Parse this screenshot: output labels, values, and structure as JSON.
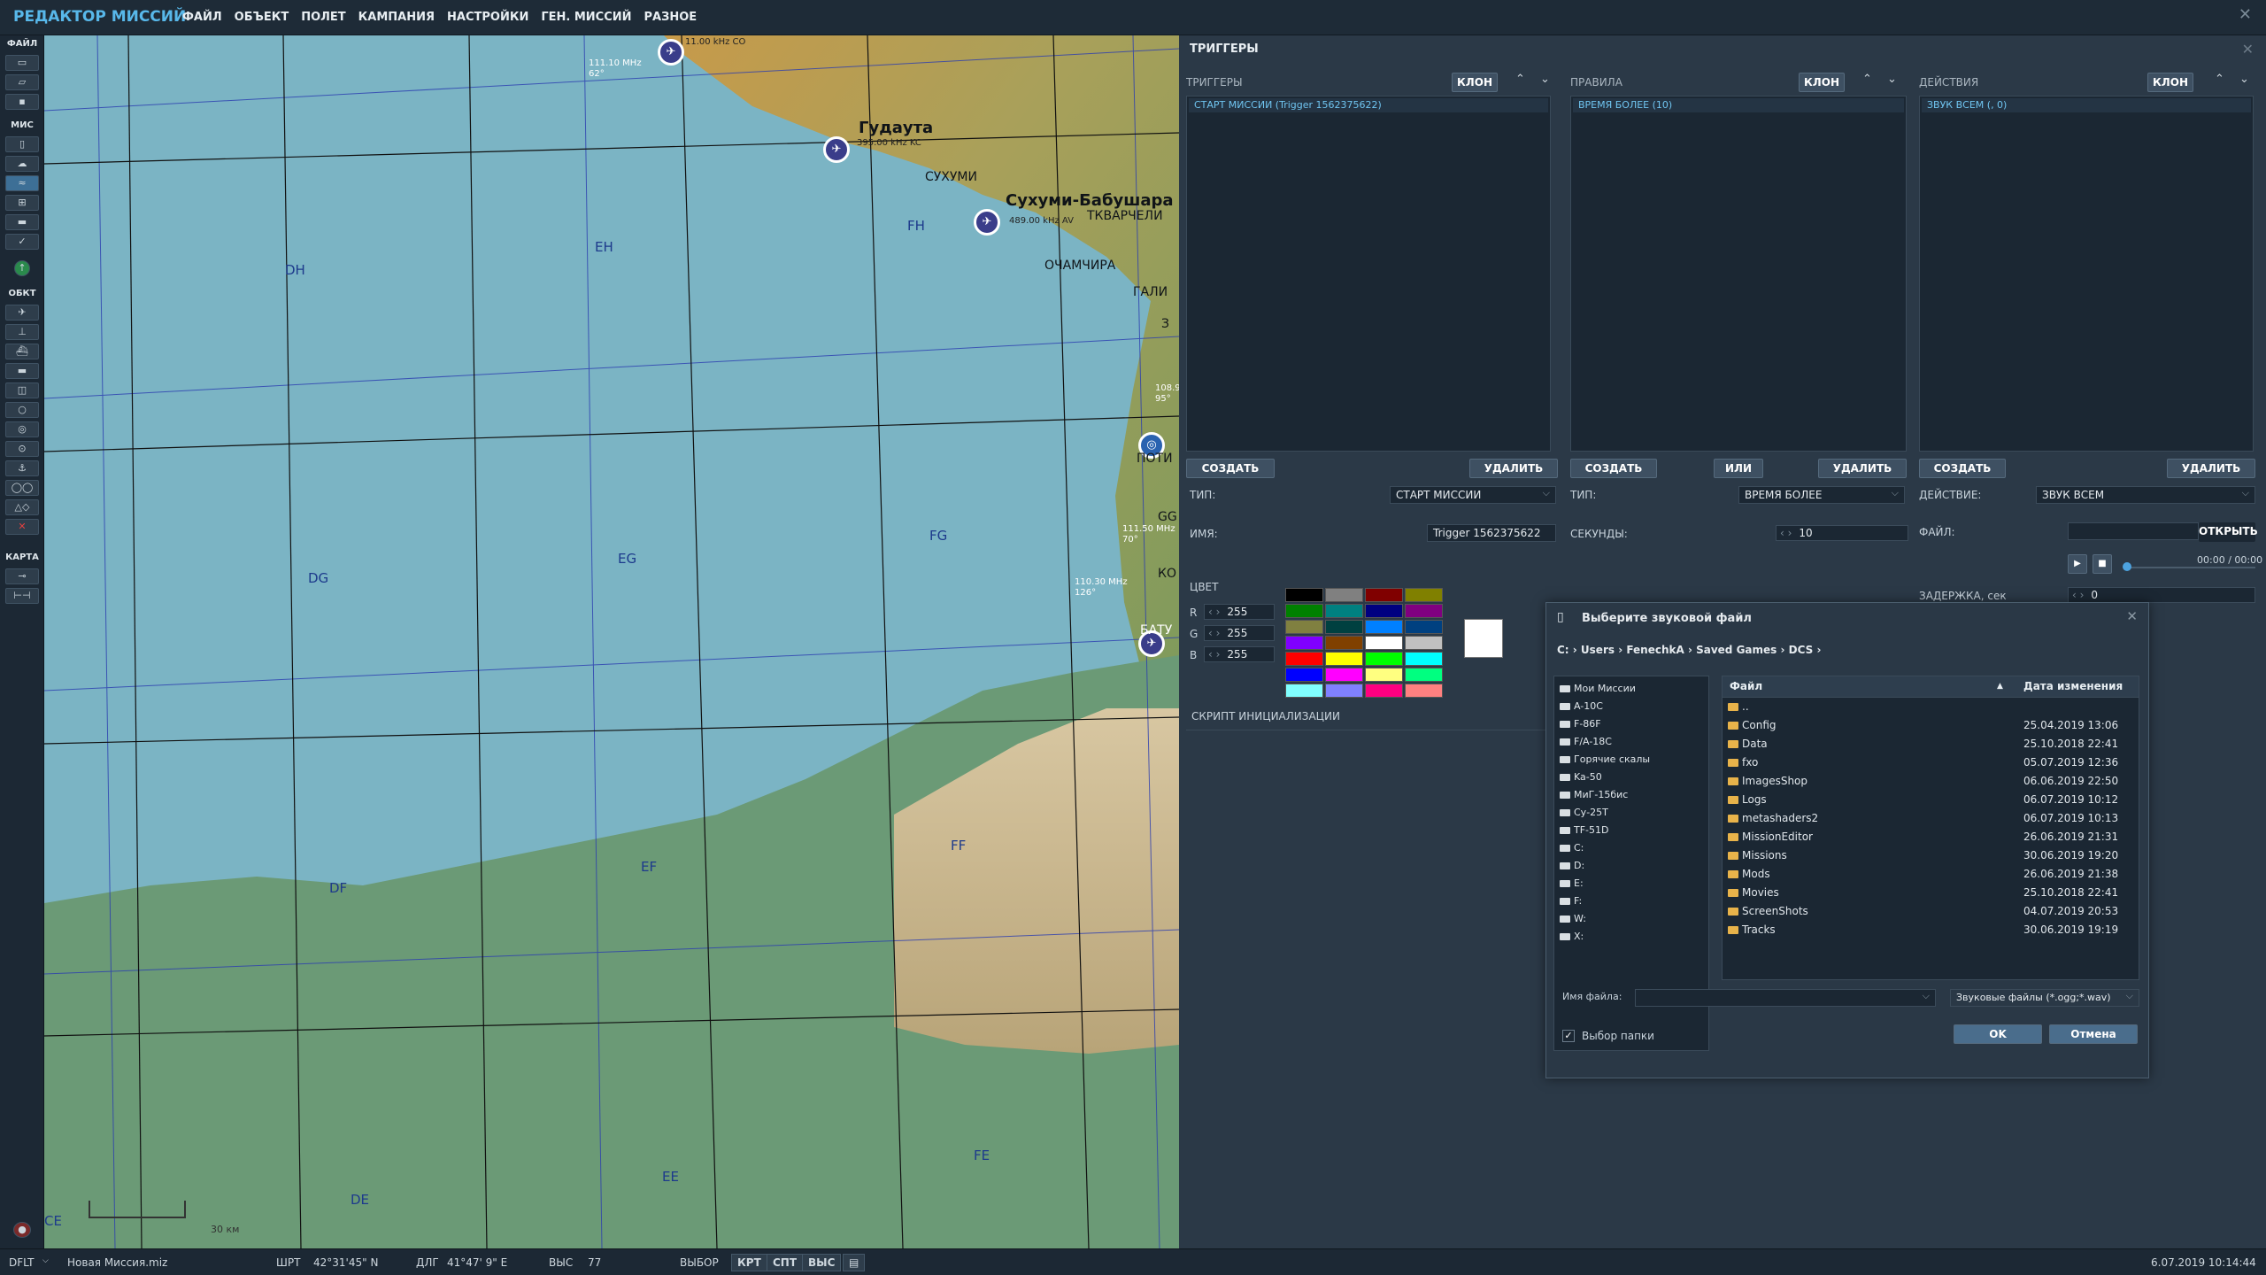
{
  "app": {
    "title": "РЕДАКТОР МИССИЙ",
    "close": "✕"
  },
  "menu": [
    "ФАЙЛ",
    "ОБЪЕКТ",
    "ПОЛЕТ",
    "КАМПАНИЯ",
    "НАСТРОЙКИ",
    "ГЕН. МИССИЙ",
    "РАЗНОЕ"
  ],
  "toolbar": {
    "section_file": "ФАЙЛ",
    "section_mis": "МИС",
    "section_obj": "ОБКТ",
    "section_map": "КАРТА"
  },
  "map": {
    "grid_labels": [
      "DH",
      "EH",
      "FH",
      "DG",
      "EG",
      "FG",
      "DF",
      "EF",
      "FF",
      "DE",
      "EE",
      "FE",
      "CE"
    ],
    "places": {
      "gudauta": "Гудаута",
      "sukhumi_babushara": "Сухуми-Бабушара",
      "sukhumi": "СУХУМИ",
      "ochamchira": "ОЧАМЧИРА",
      "tkvarcheli": "ТКВАРЧЕЛИ",
      "gali": "ГАЛИ",
      "poti": "ПОТИ",
      "batumi": "БАТУ",
      "kobuleti": "КО",
      "gg": "GG",
      "z": "З"
    },
    "freq": {
      "f1": "111.10 MHz",
      "f1b": "62°",
      "f2": "395.00 kHz KC",
      "f3": "11.00 kHz CO",
      "f4": "489.00 kHz AV",
      "f5": "111.50 MHz",
      "f5b": "70°",
      "f6": "110.30 MHz",
      "f6b": "126°",
      "f7": "108.9",
      "f7b": "95°"
    },
    "scale": "30 км"
  },
  "triggers": {
    "title": "ТРИГГЕРЫ",
    "cols": {
      "triggers": {
        "title": "ТРИГГЕРЫ",
        "clone": "КЛОН",
        "items": [
          "СТАРТ МИССИИ (Trigger 1562375622)"
        ],
        "create": "СОЗДАТЬ",
        "delete": "УДАЛИТЬ"
      },
      "rules": {
        "title": "ПРАВИЛА",
        "clone": "КЛОН",
        "items": [
          "ВРЕМЯ БОЛЕЕ (10)"
        ],
        "create": "СОЗДАТЬ",
        "or": "ИЛИ",
        "delete": "УДАЛИТЬ"
      },
      "actions": {
        "title": "ДЕЙСТВИЯ",
        "clone": "КЛОН",
        "items": [
          "ЗВУК ВСЕМ (, 0)"
        ],
        "create": "СОЗДАТЬ",
        "delete": "УДАЛИТЬ"
      }
    },
    "type_label": "ТИП:",
    "type_value": "СТАРТ МИССИИ",
    "name_label": "ИМЯ:",
    "name_value": "Trigger 1562375622",
    "color_label": "ЦВЕТ",
    "r_label": "R",
    "g_label": "G",
    "b_label": "B",
    "r": "255",
    "g": "255",
    "b": "255",
    "script_label": "СКРИПТ ИНИЦИАЛИЗАЦИИ",
    "rule_type_label": "ТИП:",
    "rule_type_value": "ВРЕМЯ БОЛЕЕ",
    "seconds_label": "СЕКУНДЫ:",
    "seconds_value": "10",
    "action_label": "ДЕЙСТВИЕ:",
    "action_value": "ЗВУК ВСЕМ",
    "file_label": "ФАЙЛ:",
    "open": "ОТКРЫТЬ",
    "time": "00:00 / 00:00",
    "delay_label": "ЗАДЕРЖКА, сек",
    "delay_value": "0",
    "palette": [
      "#000000",
      "#808080",
      "#800000",
      "#808000",
      "#008000",
      "#008080",
      "#000080",
      "#800080",
      "#808040",
      "#004040",
      "#0080ff",
      "#004080",
      "#8000ff",
      "#804000",
      "#ffffff",
      "#c0c0c0",
      "#ff0000",
      "#ffff00",
      "#00ff00",
      "#00ffff",
      "#0000ff",
      "#ff00ff",
      "#ffff80",
      "#00ff80",
      "#80ffff",
      "#8080ff",
      "#ff0080",
      "#ff8080"
    ]
  },
  "dialog": {
    "title": "Выберите звуковой файл",
    "path": [
      "C:",
      "Users",
      "FenechkA",
      "Saved Games",
      "DCS"
    ],
    "tree": [
      "Мои Миссии",
      "A-10C",
      "F-86F",
      "F/A-18C",
      "Горячие скалы",
      "Ka-50",
      "МиГ-15бис",
      "Су-25Т",
      "TF-51D",
      "C:",
      "D:",
      "E:",
      "F:",
      "W:",
      "X:"
    ],
    "col_file": "Файл",
    "col_date": "Дата изменения",
    "files": [
      {
        "name": "..",
        "date": ""
      },
      {
        "name": "Config",
        "date": "25.04.2019 13:06"
      },
      {
        "name": "Data",
        "date": "25.10.2018 22:41"
      },
      {
        "name": "fxo",
        "date": "05.07.2019 12:36"
      },
      {
        "name": "ImagesShop",
        "date": "06.06.2019 22:50"
      },
      {
        "name": "Logs",
        "date": "06.07.2019 10:12"
      },
      {
        "name": "metashaders2",
        "date": "06.07.2019 10:13"
      },
      {
        "name": "MissionEditor",
        "date": "26.06.2019 21:31"
      },
      {
        "name": "Missions",
        "date": "30.06.2019 19:20"
      },
      {
        "name": "Mods",
        "date": "26.06.2019 21:38"
      },
      {
        "name": "Movies",
        "date": "25.10.2018 22:41"
      },
      {
        "name": "ScreenShots",
        "date": "04.07.2019 20:53"
      },
      {
        "name": "Tracks",
        "date": "30.06.2019 19:19"
      }
    ],
    "filename_label": "Имя файла:",
    "filename_value": "",
    "filter": "Звуковые файлы (*.ogg;*.wav)",
    "folder_select": "Выбор папки",
    "ok": "OK",
    "cancel": "Отмена"
  },
  "status": {
    "mode": "DFLT",
    "file": "Новая Миссия.miz",
    "lat_label": "ШРТ",
    "lat": "42°31'45\" N",
    "lon_label": "ДЛГ",
    "lon": "41°47' 9\" E",
    "alt_label": "ВЫС",
    "alt": "77",
    "select": "ВЫБОР",
    "b1": "КРТ",
    "b2": "СПТ",
    "b3": "ВЫС",
    "datetime": "6.07.2019 10:14:44"
  }
}
